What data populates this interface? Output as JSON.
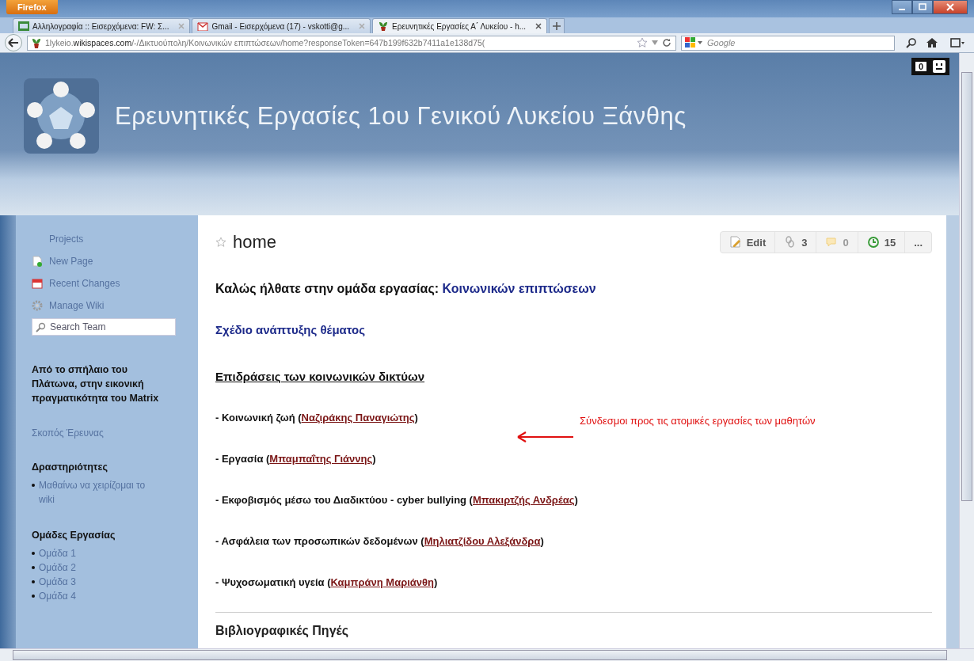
{
  "browser": {
    "menu_button": "Firefox",
    "tabs": [
      {
        "title": "Αλληλογραφία :: Εισερχόμενα: FW: Σ...",
        "kind": "mail",
        "selected": false
      },
      {
        "title": "Gmail - Εισερχόμενα (17) - vskotti@g...",
        "kind": "gmail",
        "selected": false
      },
      {
        "title": "Ερευνητικές Εργασίες Α΄ Λυκείου - h...",
        "kind": "site",
        "selected": true
      }
    ],
    "url": "1lykeio.**wikispaces.com**/-/Δικτυούπολη/Κοινωνικών επιπτώσεων/home?responseToken=647b199f632b7411a1e138d75(",
    "search": {
      "placeholder": "Google"
    }
  },
  "site": {
    "title": "Ερευνητικές Εργασίες 1ου Γενικού Λυκείου Ξάνθης",
    "counter": "0"
  },
  "sidebar": {
    "items": [
      {
        "label": "Projects",
        "kind": "plain"
      },
      {
        "label": "New Page",
        "kind": "new-page"
      },
      {
        "label": "Recent Changes",
        "kind": "recent"
      },
      {
        "label": "Manage Wiki",
        "kind": "manage"
      }
    ],
    "search": {
      "placeholder": "Search Team"
    },
    "heading": "Από το σπήλαιο του Πλάτωνα, στην εικονική πραγματικότητα του Matrix",
    "link": "Σκοπός Έρευνας",
    "sections": [
      {
        "title": "Δραστηριότητες",
        "items": [
          "Μαθαίνω να χειρίζομαι το wiki"
        ]
      },
      {
        "title": "Ομάδες Εργασίας",
        "items": [
          "Ομάδα 1",
          "Ομάδα 2",
          "Ομάδα 3",
          "Ομάδα 4"
        ]
      }
    ]
  },
  "page": {
    "title": "home",
    "toolbar": [
      {
        "kind": "edit",
        "label": "Edit",
        "disabled": false
      },
      {
        "kind": "links",
        "label": "3",
        "disabled": false
      },
      {
        "kind": "comments",
        "label": "0",
        "disabled": true
      },
      {
        "kind": "history",
        "label": "15",
        "disabled": false
      },
      {
        "kind": "more",
        "label": "...",
        "disabled": false
      }
    ],
    "welcome": {
      "text": "Καλώς ήλθατε στην ομάδα εργασίας: ",
      "link": "Κοινωνικών επιπτώσεων"
    },
    "plan_link": "Σχέδιο ανάπτυξης θέματος",
    "section_heading": "Επιδράσεις των κοινωνικών δικτύων",
    "entries": [
      {
        "text": "- Κοινωνική ζωή (",
        "author": "Ναζιράκης Παναγιώτης",
        "close": ")"
      },
      {
        "text": "- Εργασία (",
        "author": "Μπαμπαΐτης Γιάννης",
        "close": ")"
      },
      {
        "text": "- Εκφοβισμός μέσω του Διαδικτύου - cyber bullying (",
        "author": "Μπακιρτζής Ανδρέας",
        "close": ")"
      },
      {
        "text": "- Ασφάλεια των προσωπικών δεδομένων (",
        "author": "Μηλιατζίδου Αλεξάνδρα",
        "close": ")"
      },
      {
        "text": "- Ψυχοσωματική υγεία (",
        "author": "Καμπράνη Μαριάνθη",
        "close": ")"
      }
    ],
    "annotation": "Σύνδεσμοι προς τις ατομικές εργασίες των μαθητών",
    "footer_heading": "Βιβλιογραφικές Πηγές"
  }
}
